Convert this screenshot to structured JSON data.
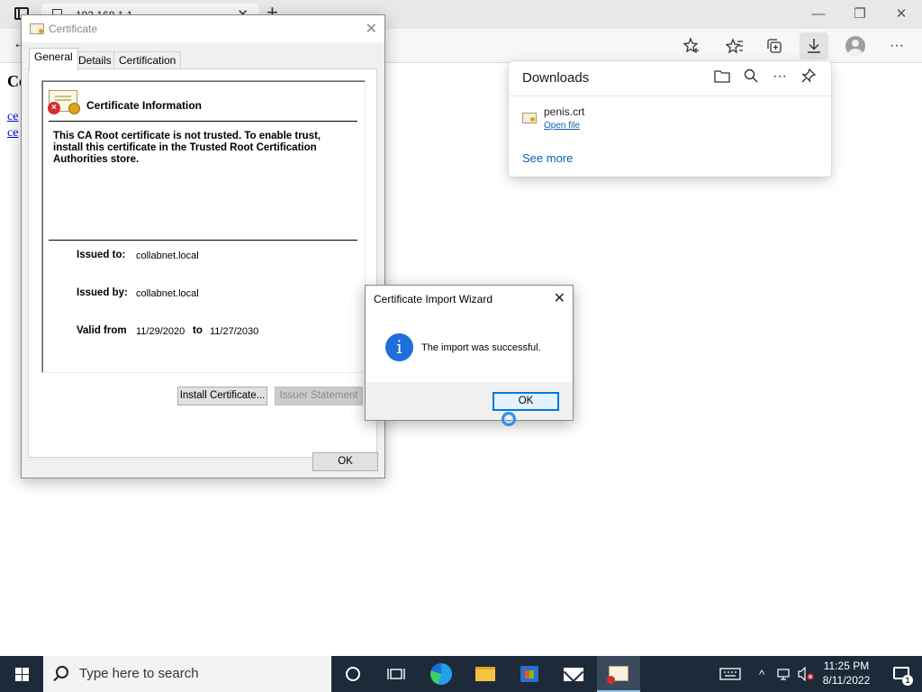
{
  "browser": {
    "tab_title": "192.168.1.1",
    "tab_close": "✕",
    "new_tab": "+",
    "window_controls": {
      "minimize": "—",
      "restore": "❐",
      "close": "✕"
    },
    "toolbar": {
      "back": "←",
      "add_favorite_icon": "star-plus-icon",
      "favorites_icon": "favorites-icon",
      "collections_icon": "collections-icon",
      "downloads_icon": "download-icon",
      "more": "···"
    }
  },
  "page": {
    "heading": "Ce",
    "links": [
      "ce",
      "ce"
    ]
  },
  "downloads": {
    "title": "Downloads",
    "icons": {
      "open_folder": "🗀",
      "search": "⚲",
      "more": "···",
      "pin": "📌"
    },
    "items": [
      {
        "file_name": "penis.crt",
        "action": "Open file"
      }
    ],
    "see_more": "See more"
  },
  "certificate_dialog": {
    "title": "Certificate",
    "close": "✕",
    "tabs": [
      "General",
      "Details",
      "Certification Path"
    ],
    "selected_tab": "General",
    "info_title": "Certificate Information",
    "warning": "This CA Root certificate is not trusted. To enable trust, install this certificate in the Trusted Root Certification Authorities store.",
    "issued_to_label": "Issued to:",
    "issued_to": "collabnet.local",
    "issued_by_label": "Issued by:",
    "issued_by": "collabnet.local",
    "valid_from_label": "Valid from",
    "valid_from": "11/29/2020",
    "to_label": "to",
    "valid_to": "11/27/2030",
    "install_button": "Install Certificate...",
    "issuer_statement_button": "Issuer Statement",
    "ok_button": "OK"
  },
  "import_wizard": {
    "title": "Certificate Import Wizard",
    "close": "✕",
    "icon": "i",
    "message": "The import was successful.",
    "ok_button": "OK"
  },
  "taskbar": {
    "search_placeholder": "Type here to search",
    "time": "11:25 PM",
    "date": "8/11/2022",
    "notification_count": "1",
    "tray": {
      "chevron": "^"
    },
    "colors": {
      "background": "#1c2a3a",
      "accent": "#0078d7"
    }
  }
}
